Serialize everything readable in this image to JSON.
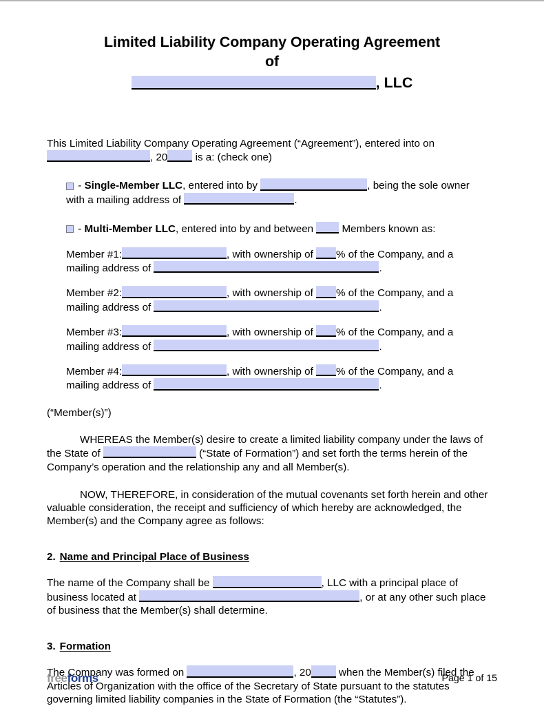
{
  "document": {
    "title_line1": "Limited Liability Company Operating Agreement",
    "title_line2": "of",
    "title_suffix": ", LLC"
  },
  "intro": {
    "text_1": "This Limited Liability Company Operating Agreement (“Agreement”), entered into on",
    "text_2a": ", 20",
    "text_2b": " is a: (check one)"
  },
  "single_member": {
    "dash": " - ",
    "label": "Single-Member LLC",
    "text_1": ", entered into by ",
    "text_2": ", being the sole owner",
    "text_3": "with a mailing address of ",
    "text_4": "."
  },
  "multi_member": {
    "dash": " - ",
    "label": "Multi-Member LLC",
    "text_1": ", entered into by and between ",
    "text_2": " Members known as:"
  },
  "members": [
    {
      "label": "Member #1:",
      "text_1": ", with ownership of ",
      "text_2": "% of the Company, and a",
      "text_3": "mailing address of ",
      "text_4": "."
    },
    {
      "label": "Member #2:",
      "text_1": ", with ownership of ",
      "text_2": "% of the Company, and a",
      "text_3": "mailing address of ",
      "text_4": "."
    },
    {
      "label": "Member #3:",
      "text_1": ", with ownership of ",
      "text_2": "% of the Company, and a",
      "text_3": "mailing address of ",
      "text_4": "."
    },
    {
      "label": "Member #4:",
      "text_1": ", with ownership of ",
      "text_2": "% of the Company, and a",
      "text_3": "mailing address of ",
      "text_4": "."
    }
  ],
  "members_tag": "(“Member(s)”)",
  "whereas": {
    "text_1": "WHEREAS the Member(s) desire to create a limited liability company under the laws of the State of ",
    "text_2": " (“State of Formation”) and set forth the terms herein of the Company’s operation and the relationship any and all Member(s)."
  },
  "therefore": {
    "text": "NOW, THEREFORE, in consideration of the mutual covenants set forth herein and other valuable consideration, the receipt and sufficiency of which hereby are acknowledged, the Member(s) and the Company agree as follows:"
  },
  "section_2": {
    "number": "2.",
    "title": "Name and Principal Place of Business",
    "text_1": "The name of the Company shall be ",
    "text_2": ", LLC with a principal place of business located at ",
    "text_3": ", or at any other such place of business that the Member(s) shall determine."
  },
  "section_3": {
    "number": "3.",
    "title": "Formation",
    "text_1": "The Company was formed on ",
    "text_2": ", 20",
    "text_3": " when the Member(s) filed the Articles of Organization with the office of the Secretary of State pursuant to the statutes governing limited liability companies in the State of Formation (the “Statutes”)."
  },
  "footer": {
    "logo_part1": "free",
    "logo_part2": "forms",
    "page_number": "Page 1 of 15"
  },
  "colors": {
    "field_fill": "#ccd2f7",
    "field_rule": "#000000",
    "logo_free": "#9a9a9a",
    "logo_forms": "#1f3f8f",
    "page_border": "#b4b4b4"
  }
}
